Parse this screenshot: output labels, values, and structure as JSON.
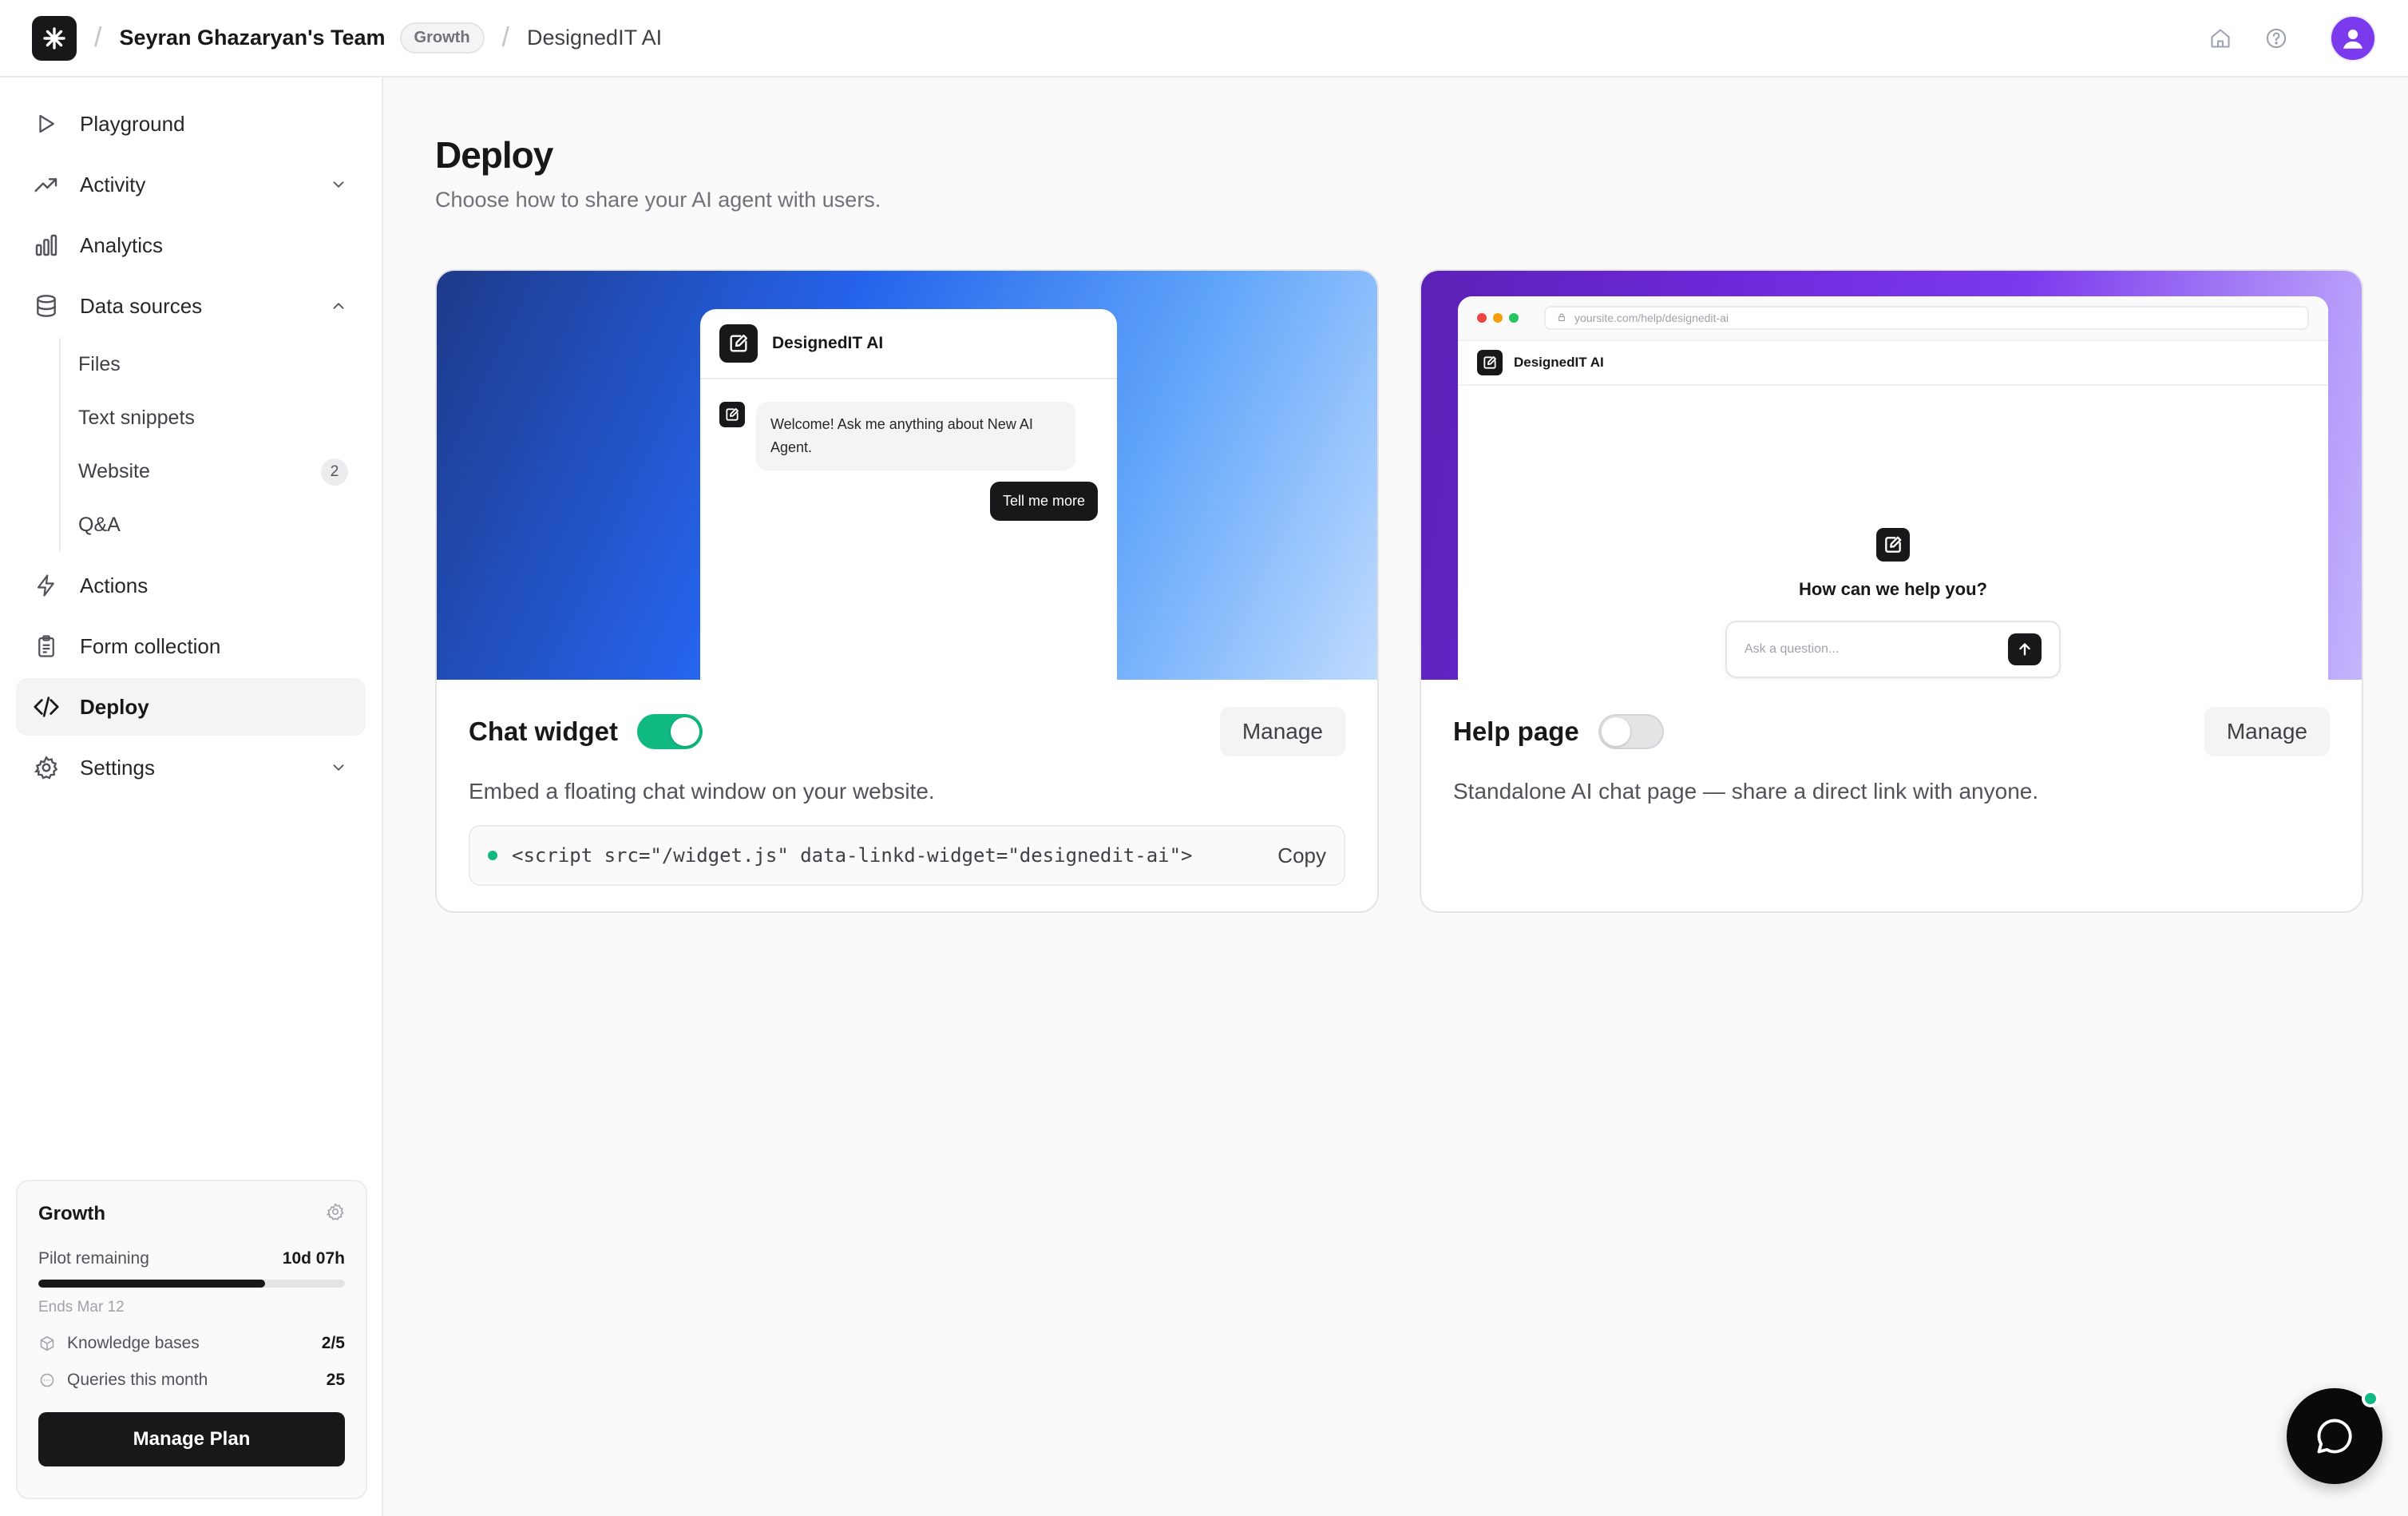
{
  "topbar": {
    "team_name": "Seyran Ghazaryan's Team",
    "plan_badge": "Growth",
    "project_name": "DesignedIT AI"
  },
  "sidebar": {
    "items": [
      {
        "label": "Playground",
        "icon": "play-icon"
      },
      {
        "label": "Activity",
        "icon": "trend-icon",
        "chevron": "down"
      },
      {
        "label": "Analytics",
        "icon": "bar-chart-icon"
      },
      {
        "label": "Data sources",
        "icon": "database-icon",
        "chevron": "up"
      },
      {
        "label": "Actions",
        "icon": "bolt-icon"
      },
      {
        "label": "Form collection",
        "icon": "clipboard-icon"
      },
      {
        "label": "Deploy",
        "icon": "code-icon",
        "active": true
      },
      {
        "label": "Settings",
        "icon": "gear-icon",
        "chevron": "down"
      }
    ],
    "data_sources_sub": [
      {
        "label": "Files"
      },
      {
        "label": "Text snippets"
      },
      {
        "label": "Website",
        "badge": "2"
      },
      {
        "label": "Q&A"
      }
    ],
    "plan_card": {
      "title": "Growth",
      "pilot_label": "Pilot remaining",
      "pilot_value": "10d 07h",
      "progress_fraction": 0.74,
      "ends": "Ends Mar 12",
      "kb_label": "Knowledge bases",
      "kb_value": "2/5",
      "queries_label": "Queries this month",
      "queries_value": "25",
      "button": "Manage Plan"
    }
  },
  "main": {
    "title": "Deploy",
    "subtitle": "Choose how to share your AI agent with users.",
    "chat_widget": {
      "title": "Chat widget",
      "enabled": true,
      "manage_label": "Manage",
      "description": "Embed a floating chat window on your website.",
      "code": "<script src=\"/widget.js\" data-linkd-widget=\"designedit-ai\">",
      "copy_label": "Copy",
      "preview": {
        "name": "DesignedIT AI",
        "bot_message": "Welcome! Ask me anything about New AI Agent.",
        "user_message": "Tell me more"
      }
    },
    "help_page": {
      "title": "Help page",
      "enabled": false,
      "manage_label": "Manage",
      "description": "Standalone AI chat page — share a direct link with anyone.",
      "preview": {
        "url": "yoursite.com/help/designedit-ai",
        "brand": "DesignedIT AI",
        "question": "How can we help you?",
        "placeholder": "Ask a question..."
      }
    }
  },
  "colors": {
    "accent_green": "#10b981",
    "avatar_purple": "#7c3aed",
    "dark": "#18181b"
  }
}
